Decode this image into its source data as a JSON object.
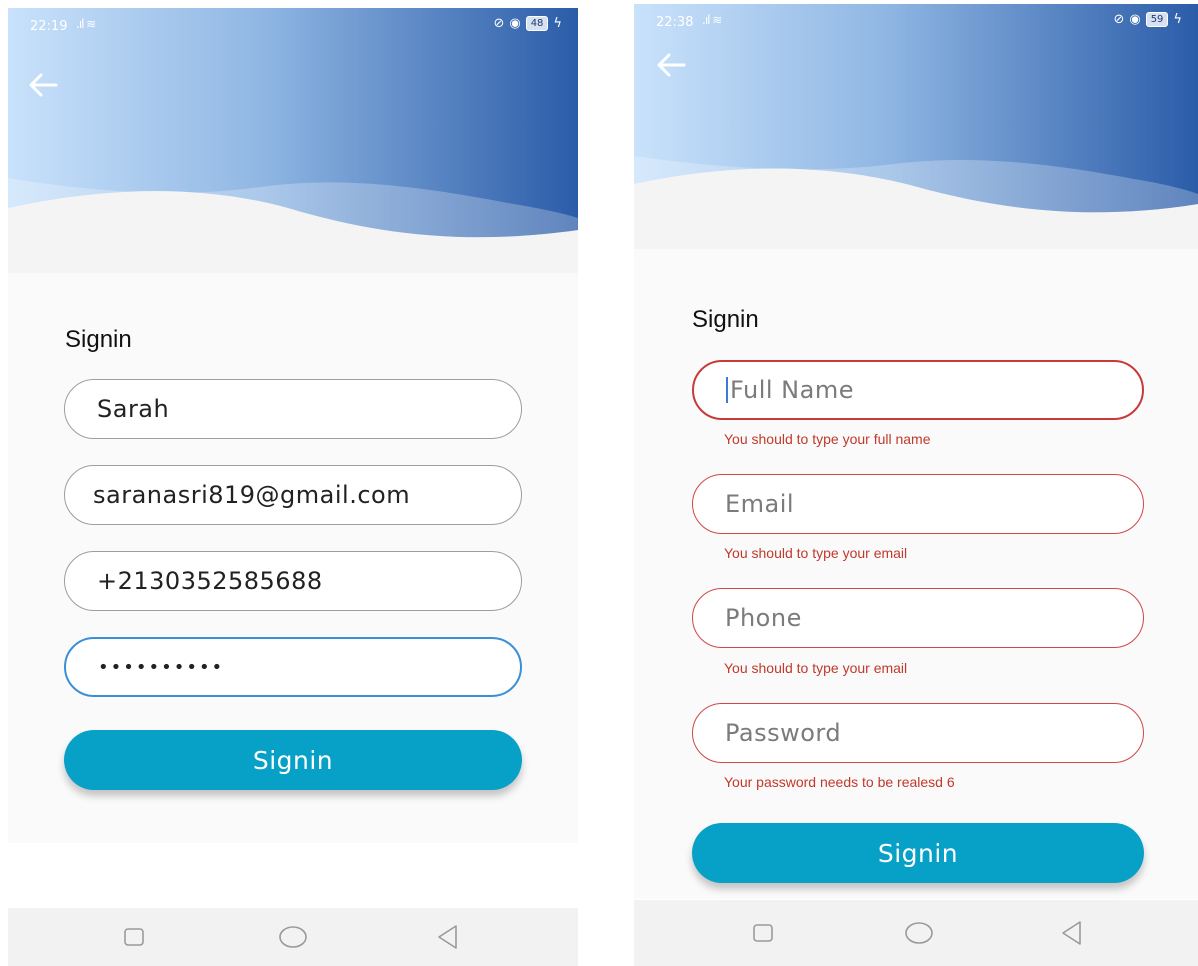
{
  "left": {
    "status": {
      "time": "22:19",
      "battery": "48"
    },
    "title": "Signin",
    "fields": [
      {
        "name": "fullname",
        "value": "Sarah"
      },
      {
        "name": "email",
        "value": "saranasri819@gmail.com"
      },
      {
        "name": "phone",
        "value": "+2130352585688"
      },
      {
        "name": "password",
        "value": "••••••••••"
      }
    ],
    "button_label": "Signin"
  },
  "right": {
    "status": {
      "time": "22:38",
      "battery": "59"
    },
    "title": "Signin",
    "fields": [
      {
        "placeholder": "Full Name",
        "error": "You should to type your full name"
      },
      {
        "placeholder": "Email",
        "error": "You should to type your email"
      },
      {
        "placeholder": "Phone",
        "error": "You should to type your email"
      },
      {
        "placeholder": "Password",
        "error": "Your password needs to be realesd 6"
      }
    ],
    "button_label": "Signin"
  },
  "colors": {
    "header_light": "#c9e2fb",
    "header_dark": "#2b5ca8",
    "button": "#07a0c7",
    "focus_border": "#3b8fd6",
    "error": "#c0392b"
  },
  "icons": {
    "back": "arrow-left-icon",
    "nav": [
      "recent-apps-icon",
      "home-icon",
      "back-triangle-icon"
    ]
  }
}
